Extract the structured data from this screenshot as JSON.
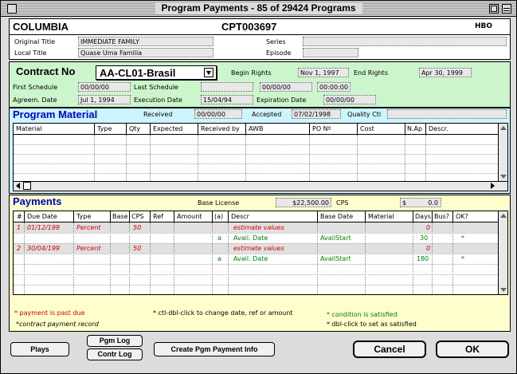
{
  "window": {
    "title": "Program Payments - 85 of 29424 Programs"
  },
  "header": {
    "network": "COLUMBIA",
    "program_id": "CPT003697",
    "channel": "HBO",
    "original_title_label": "Original Title",
    "original_title": "IMMEDIATE FAMILY",
    "local_title_label": "Local Title",
    "local_title": "Quase Uma Familia",
    "series_label": "Series",
    "series": "",
    "episode_label": "Episode",
    "episode": ""
  },
  "contract": {
    "label": "Contract No",
    "number": "AA-CL01-Brasil",
    "begin_rights_label": "Begin Rights",
    "begin_rights": "Nov 1, 1997",
    "end_rights_label": "End Rights",
    "end_rights": "Apr 30, 1999",
    "first_schedule_label": "First Schedule",
    "first_schedule": "00/00/00",
    "last_schedule_label": "Last Schedule",
    "last_schedule_a": "",
    "last_schedule_b": "00/00/00",
    "last_schedule_time": "00:00:00",
    "agreem_label": "Agreem. Date",
    "agreem_date": "Jul 1, 1994",
    "execution_label": "Execution Date",
    "execution_date": "15/04/94",
    "expiration_label": "Expiration Date",
    "expiration_date": "00/00/00"
  },
  "program_material": {
    "title": "Program Material",
    "received_label": "Received",
    "received": "00/00/00",
    "accepted_label": "Accepted",
    "accepted": "07/02/1998",
    "quality_label": "Quality Ctl",
    "quality": "",
    "columns": [
      "Material",
      "Type",
      "Qty",
      "Expected",
      "Received by",
      "AWB",
      "PO Nº",
      "Cost",
      "N.Ap",
      "Descr."
    ]
  },
  "payments": {
    "title": "Payments",
    "base_license_label": "Base License",
    "base_license": "$22,500.00",
    "cps_label": "CPS",
    "cps_currency": "$",
    "cps_value": "0.0",
    "columns": [
      "#",
      "Due Date",
      "Type",
      "Base",
      "CPS",
      "Ref",
      "Amount",
      "(a)",
      "Descr",
      "Base Date",
      "Material",
      "Days",
      "Bus?",
      "OK?"
    ],
    "rows": [
      {
        "num": "1",
        "due": "01/12/199",
        "type": "Percent",
        "cps": "50",
        "descr": "estimate values",
        "days": "0",
        "shaded": true
      },
      {
        "a": "a",
        "descr": "Avail. Date",
        "base_date": "AvailStart",
        "days": "30",
        "ok": "*"
      },
      {
        "num": "2",
        "due": "30/04/199",
        "type": "Percent",
        "cps": "50",
        "descr": "estimate values",
        "days": "0",
        "shaded": true
      },
      {
        "a": "a",
        "descr": "Avail. Date",
        "base_date": "AvailStart",
        "days": "180",
        "ok": "*"
      }
    ],
    "legend": {
      "past_due": "* payment is past due",
      "contract_record": "*contract payment record",
      "ctl_dbl": "* ctl-dbl-click to change date, ref or amount",
      "condition": "* condition is satisfied",
      "dbl_click": "* dbl-click to set as satisfied"
    }
  },
  "buttons": {
    "plays": "Plays",
    "pgm_log": "Pgm Log",
    "contr_log": "Contr Log",
    "create_payment": "Create Pgm Payment Info",
    "cancel": "Cancel",
    "ok": "OK"
  },
  "colors": {
    "contract_bg": "#ccf5cc",
    "material_bg": "#ccf5ff",
    "payments_bg": "#ffffcc",
    "section_title": "#0000cc",
    "past_due": "#d00000",
    "satisfied": "#008000"
  }
}
